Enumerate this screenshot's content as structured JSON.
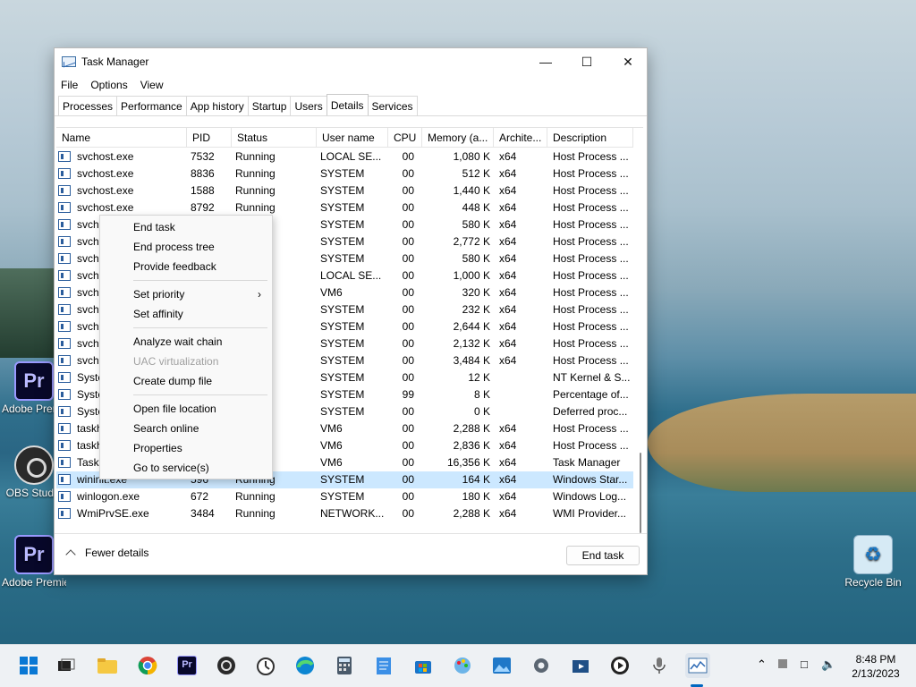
{
  "window": {
    "title": "Task Manager",
    "minimize_glyph": "—",
    "maximize_glyph": "☐",
    "close_glyph": "✕"
  },
  "menubar": [
    "File",
    "Options",
    "View"
  ],
  "tabs": [
    "Processes",
    "Performance",
    "App history",
    "Startup",
    "Users",
    "Details",
    "Services"
  ],
  "active_tab": "Details",
  "columns": [
    "Name",
    "PID",
    "Status",
    "User name",
    "CPU",
    "Memory (a...",
    "Archite...",
    "Description"
  ],
  "rows": [
    {
      "name": "svchost.exe",
      "pid": "7532",
      "status": "Running",
      "user": "LOCAL SE...",
      "cpu": "00",
      "mem": "1,080 K",
      "arch": "x64",
      "desc": "Host Process ..."
    },
    {
      "name": "svchost.exe",
      "pid": "8836",
      "status": "Running",
      "user": "SYSTEM",
      "cpu": "00",
      "mem": "512 K",
      "arch": "x64",
      "desc": "Host Process ..."
    },
    {
      "name": "svchost.exe",
      "pid": "1588",
      "status": "Running",
      "user": "SYSTEM",
      "cpu": "00",
      "mem": "1,440 K",
      "arch": "x64",
      "desc": "Host Process ..."
    },
    {
      "name": "svchost.exe",
      "pid": "8792",
      "status": "Running",
      "user": "SYSTEM",
      "cpu": "00",
      "mem": "448 K",
      "arch": "x64",
      "desc": "Host Process ..."
    },
    {
      "name": "svcho",
      "pid": "",
      "status": "",
      "user": "SYSTEM",
      "cpu": "00",
      "mem": "580 K",
      "arch": "x64",
      "desc": "Host Process ..."
    },
    {
      "name": "svcho",
      "pid": "",
      "status": "",
      "user": "SYSTEM",
      "cpu": "00",
      "mem": "2,772 K",
      "arch": "x64",
      "desc": "Host Process ..."
    },
    {
      "name": "svcho",
      "pid": "",
      "status": "",
      "user": "SYSTEM",
      "cpu": "00",
      "mem": "580 K",
      "arch": "x64",
      "desc": "Host Process ..."
    },
    {
      "name": "svcho",
      "pid": "",
      "status": "",
      "user": "LOCAL SE...",
      "cpu": "00",
      "mem": "1,000 K",
      "arch": "x64",
      "desc": "Host Process ..."
    },
    {
      "name": "svcho",
      "pid": "",
      "status": "",
      "user": "VM6",
      "cpu": "00",
      "mem": "320 K",
      "arch": "x64",
      "desc": "Host Process ..."
    },
    {
      "name": "svcho",
      "pid": "",
      "status": "",
      "user": "SYSTEM",
      "cpu": "00",
      "mem": "232 K",
      "arch": "x64",
      "desc": "Host Process ..."
    },
    {
      "name": "svcho",
      "pid": "",
      "status": "",
      "user": "SYSTEM",
      "cpu": "00",
      "mem": "2,644 K",
      "arch": "x64",
      "desc": "Host Process ..."
    },
    {
      "name": "svcho",
      "pid": "",
      "status": "",
      "user": "SYSTEM",
      "cpu": "00",
      "mem": "2,132 K",
      "arch": "x64",
      "desc": "Host Process ..."
    },
    {
      "name": "svcho",
      "pid": "",
      "status": "",
      "user": "SYSTEM",
      "cpu": "00",
      "mem": "3,484 K",
      "arch": "x64",
      "desc": "Host Process ..."
    },
    {
      "name": "Syste",
      "pid": "",
      "status": "",
      "user": "SYSTEM",
      "cpu": "00",
      "mem": "12 K",
      "arch": "",
      "desc": "NT Kernel & S..."
    },
    {
      "name": "Syste",
      "pid": "",
      "status": "",
      "user": "SYSTEM",
      "cpu": "99",
      "mem": "8 K",
      "arch": "",
      "desc": "Percentage of..."
    },
    {
      "name": "Syste",
      "pid": "",
      "status": "",
      "user": "SYSTEM",
      "cpu": "00",
      "mem": "0 K",
      "arch": "",
      "desc": "Deferred proc..."
    },
    {
      "name": "taskh",
      "pid": "",
      "status": "",
      "user": "VM6",
      "cpu": "00",
      "mem": "2,288 K",
      "arch": "x64",
      "desc": "Host Process ..."
    },
    {
      "name": "taskh",
      "pid": "",
      "status": "",
      "user": "VM6",
      "cpu": "00",
      "mem": "2,836 K",
      "arch": "x64",
      "desc": "Host Process ..."
    },
    {
      "name": "Taskm",
      "pid": "",
      "status": "",
      "user": "VM6",
      "cpu": "00",
      "mem": "16,356 K",
      "arch": "x64",
      "desc": "Task Manager"
    },
    {
      "name": "wininit.exe",
      "pid": "596",
      "status": "Running",
      "user": "SYSTEM",
      "cpu": "00",
      "mem": "164 K",
      "arch": "x64",
      "desc": "Windows Star...",
      "selected": true
    },
    {
      "name": "winlogon.exe",
      "pid": "672",
      "status": "Running",
      "user": "SYSTEM",
      "cpu": "00",
      "mem": "180 K",
      "arch": "x64",
      "desc": "Windows Log..."
    },
    {
      "name": "WmiPrvSE.exe",
      "pid": "3484",
      "status": "Running",
      "user": "NETWORK...",
      "cpu": "00",
      "mem": "2,288 K",
      "arch": "x64",
      "desc": "WMI Provider..."
    }
  ],
  "footer": {
    "fewer_details": "Fewer details",
    "end_task": "End task"
  },
  "context_menu": {
    "items": [
      {
        "label": "End task",
        "enabled": true
      },
      {
        "label": "End process tree",
        "enabled": true
      },
      {
        "label": "Provide feedback",
        "enabled": true
      },
      {
        "separator": true
      },
      {
        "label": "Set priority",
        "enabled": true,
        "submenu": true
      },
      {
        "label": "Set affinity",
        "enabled": true
      },
      {
        "separator": true
      },
      {
        "label": "Analyze wait chain",
        "enabled": true
      },
      {
        "label": "UAC virtualization",
        "enabled": false
      },
      {
        "label": "Create dump file",
        "enabled": true
      },
      {
        "separator": true
      },
      {
        "label": "Open file location",
        "enabled": true
      },
      {
        "label": "Search online",
        "enabled": true
      },
      {
        "label": "Properties",
        "enabled": true
      },
      {
        "label": "Go to service(s)",
        "enabled": true
      }
    ]
  },
  "desktop_icons": [
    {
      "label": "Adobe Premiere P",
      "icon": "premiere-icon",
      "glyph": "Pr"
    },
    {
      "label": "OBS Studio",
      "icon": "obs-icon"
    },
    {
      "label": "Adobe Premiere P",
      "icon": "premiere-icon",
      "glyph": "Pr"
    },
    {
      "label": "Recycle Bin",
      "icon": "recycle-bin-icon",
      "glyph": "♻"
    }
  ],
  "taskbar": {
    "apps": [
      "start",
      "task-view",
      "file-explorer",
      "chrome",
      "premiere",
      "obs",
      "clock-app",
      "edge",
      "calculator",
      "notepad",
      "store",
      "paint",
      "photos",
      "settings",
      "media",
      "player",
      "microphone",
      "task-manager"
    ],
    "time": "8:48 PM",
    "date": "2/13/2023"
  }
}
